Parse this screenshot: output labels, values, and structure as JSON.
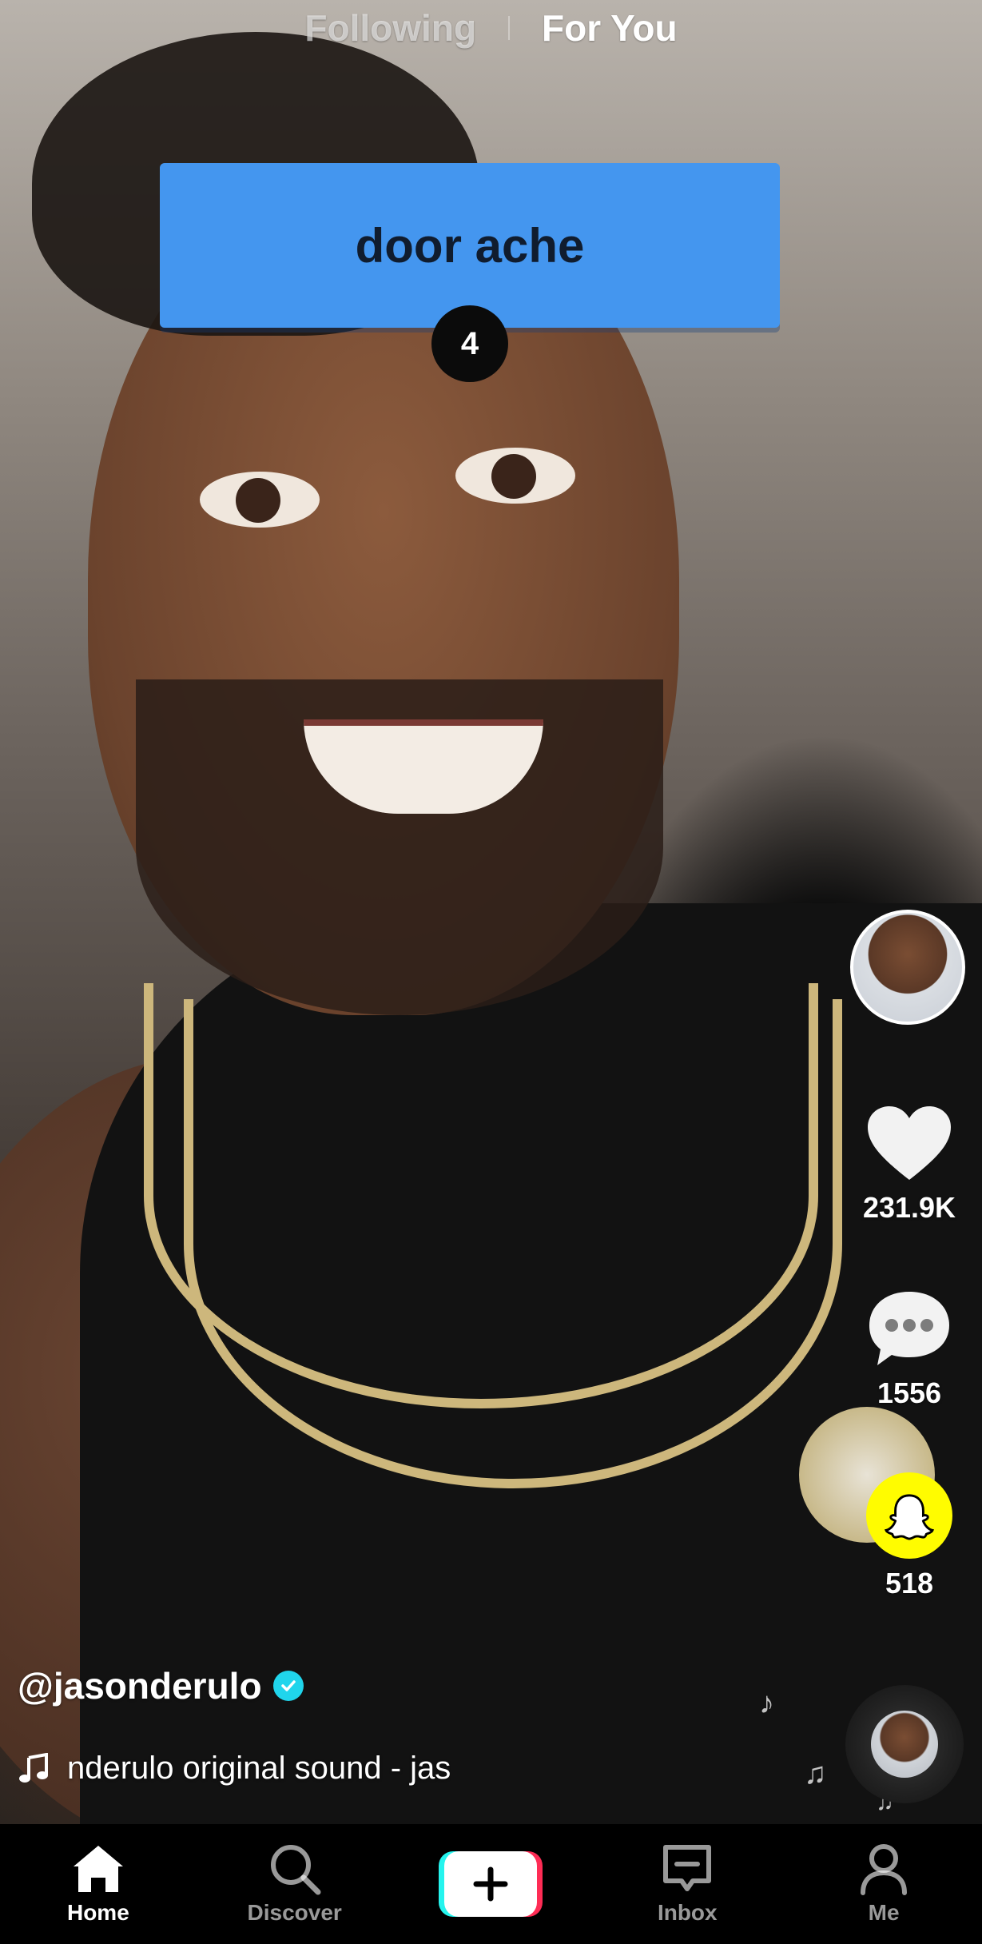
{
  "top_tabs": {
    "following": "Following",
    "for_you": "For You",
    "active": "For You"
  },
  "caption": {
    "text": "door ache",
    "counter": "4",
    "box_color": "#4496ef"
  },
  "rail": {
    "avatar_icon": "creator-avatar",
    "likes": "231.9K",
    "comments": "1556",
    "shares": "518",
    "like_icon": "heart-icon",
    "comment_icon": "comment-bubble-icon",
    "share_icon": "snapchat-ghost-icon",
    "share_color": "#fffc00"
  },
  "video_info": {
    "username": "@jasonderulo",
    "verified": true,
    "sound_text": "nderulo    original sound - jas",
    "music_icon": "music-note-icon"
  },
  "bottom_nav": {
    "items": [
      {
        "label": "Home",
        "icon": "home-icon",
        "active": true
      },
      {
        "label": "Discover",
        "icon": "search-icon",
        "active": false
      },
      {
        "label": "",
        "icon": "plus-icon",
        "active": false
      },
      {
        "label": "Inbox",
        "icon": "inbox-icon",
        "active": false
      },
      {
        "label": "Me",
        "icon": "profile-icon",
        "active": false
      }
    ]
  }
}
